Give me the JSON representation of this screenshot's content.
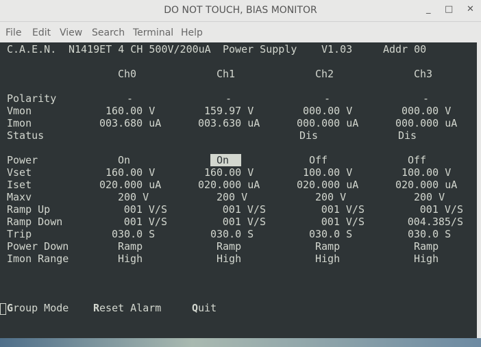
{
  "window": {
    "title": "DO NOT TOUCH, BIAS MONITOR",
    "minimize": "_",
    "maximize": "□",
    "close": "✕"
  },
  "menu": [
    "File",
    "Edit",
    "View",
    "Search",
    "Terminal",
    "Help"
  ],
  "header": {
    "maker": "C.A.E.N.",
    "model": "N1419ET 4 CH 500V/200uA",
    "product": "Power Supply",
    "version": "V1.03",
    "addr": "Addr 00"
  },
  "channels": [
    "Ch0",
    "Ch1",
    "Ch2",
    "Ch3"
  ],
  "rows": [
    {
      "label": "Polarity",
      "values": [
        "-",
        "-",
        "-",
        "-"
      ]
    },
    {
      "label": "Vmon",
      "values": [
        "160.00 V",
        "159.97 V",
        "000.00 V",
        "000.00 V"
      ]
    },
    {
      "label": "Imon",
      "values": [
        "003.680 uA",
        "003.630 uA",
        "000.000 uA",
        "000.000 uA"
      ]
    },
    {
      "label": "Status",
      "values": [
        "",
        "",
        "Dis",
        "Dis"
      ]
    },
    {
      "label": "Power",
      "values": [
        "On",
        "On",
        "Off",
        "Off"
      ]
    },
    {
      "label": "Vset",
      "values": [
        "160.00 V",
        "160.00 V",
        "100.00 V",
        "100.00 V"
      ]
    },
    {
      "label": "Iset",
      "values": [
        "020.000 uA",
        "020.000 uA",
        "020.000 uA",
        "020.000 uA"
      ]
    },
    {
      "label": "Maxv",
      "values": [
        "200 V",
        "200 V",
        "200 V",
        "200 V"
      ]
    },
    {
      "label": "Ramp Up",
      "values": [
        "001 V/S",
        "001 V/S",
        "001 V/S",
        "001 V/S"
      ]
    },
    {
      "label": "Ramp Down",
      "values": [
        "001 V/S",
        "001 V/S",
        "001 V/S",
        "004.385/S"
      ]
    },
    {
      "label": "Trip",
      "values": [
        "030.0 S",
        "030.0 S",
        "030.0 S",
        "030.0 S"
      ]
    },
    {
      "label": "Power Down",
      "values": [
        "Ramp",
        "Ramp",
        "Ramp",
        "Ramp"
      ]
    },
    {
      "label": "Imon Range",
      "values": [
        "High",
        "High",
        "High",
        "High"
      ]
    }
  ],
  "selected": {
    "row": "Power",
    "channel": "Ch1"
  },
  "commands": [
    {
      "key": "G",
      "rest": "roup Mode"
    },
    {
      "key": "R",
      "rest": "eset Alarm"
    },
    {
      "key": "Q",
      "rest": "uit"
    }
  ]
}
